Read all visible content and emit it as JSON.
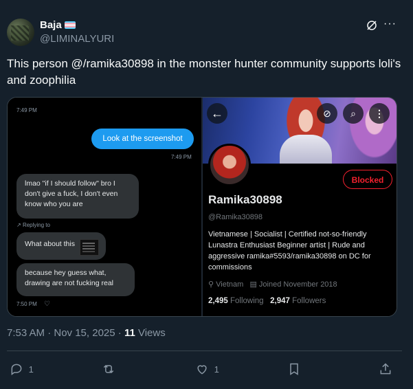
{
  "author": {
    "display_name": "Baja",
    "handle": "@LIMINALYURI"
  },
  "tweet": {
    "text": "This person @/ramika30898 in the monster hunter community supports loli's and zoophilia"
  },
  "dm_screenshot": {
    "top_timestamp": "7:49 PM",
    "sent_message": "Look at the screenshot",
    "sent_timestamp": "7:49 PM",
    "received_message": "lmao \"if I should follow\" bro I don't give a fuck, I don't even know who you are",
    "replying_to_label": "Replying to",
    "quoted_message": "What about this",
    "reply_message": "because hey guess what, drawing are not fucking real",
    "reply_timestamp": "7:50 PM"
  },
  "profile_screenshot": {
    "blocked_label": "Blocked",
    "name": "Ramika30898",
    "handle": "@Ramika30898",
    "bio": "Vietnamese | Socialist | Certified not-so-friendly Lunastra Enthusiast  Beginner artist | Rude and aggressive  ramika#5593/ramika30898 on DC for commissions",
    "location": "Vietnam",
    "joined": "Joined November 2018",
    "following_count": "2,495",
    "following_label": "Following",
    "followers_count": "2,947",
    "followers_label": "Followers"
  },
  "meta": {
    "time": "7:53 AM · Nov 15, 2025 · ",
    "views_count": "11",
    "views_label": " Views"
  },
  "actions": {
    "replies": "1",
    "likes": "1"
  },
  "colors": {
    "background": "#15202b",
    "accent": "#1d9bf0",
    "blocked_red": "#f4212e"
  }
}
